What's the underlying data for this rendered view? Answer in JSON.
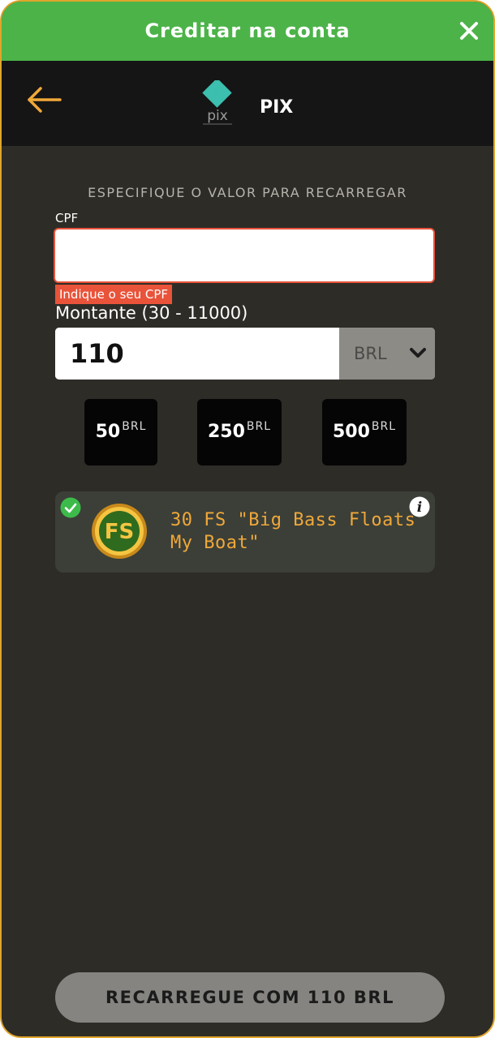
{
  "topbar": {
    "title": "Creditar na conta"
  },
  "header": {
    "method_name": "PIX",
    "logo_text": "pix"
  },
  "form": {
    "instruction": "ESPECIFIQUE O VALOR PARA RECARREGAR",
    "cpf_label": "CPF",
    "cpf_value": "",
    "cpf_error": "Indique o seu CPF",
    "amount_label": "Montante (30 - 11000)",
    "amount_value": "110",
    "currency": "BRL"
  },
  "quick_amounts": [
    {
      "value": "50",
      "currency": "BRL"
    },
    {
      "value": "250",
      "currency": "BRL"
    },
    {
      "value": "500",
      "currency": "BRL"
    }
  ],
  "bonus": {
    "icon_text": "FS",
    "text": "30 FS \"Big Bass Floats My Boat\"",
    "selected": true
  },
  "submit_label": "RECARREGUE COM 110 BRL",
  "colors": {
    "green": "#4cb349",
    "border_gold": "#e0a52c",
    "error": "#e8533a",
    "bonus_text": "#f0a83a",
    "background": "#2e2c27"
  }
}
